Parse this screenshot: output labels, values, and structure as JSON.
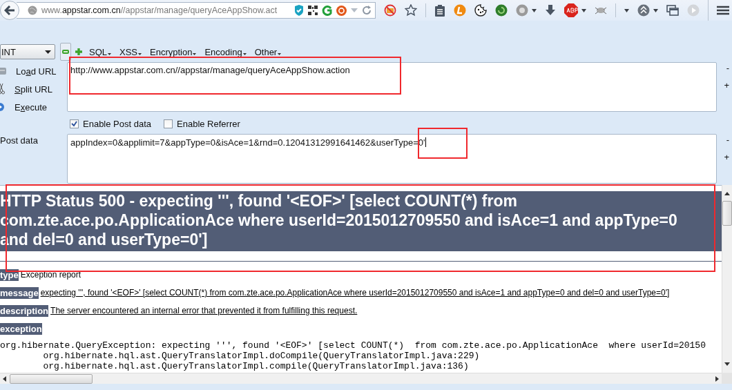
{
  "browser": {
    "address": "www.**appstar.com.cn**//appstar/manage/queryAceAppShow.act"
  },
  "hackbar": {
    "select": "INT",
    "menus": [
      "SQL",
      "XSS",
      "Encryption",
      "Encoding",
      "Other"
    ],
    "actions": [
      {
        "before": "Lo",
        "access_key": "a",
        "after": "d URL"
      },
      {
        "access_key": "S",
        "after": "plit URL"
      },
      {
        "before": "E",
        "access_key": "x",
        "after": "ecute"
      }
    ],
    "url": "http://www.appstar.com.cn//appstar/manage/queryAceAppShow.action",
    "url_side": [
      "-",
      "+"
    ],
    "options": [
      {
        "label": "Enable Post data",
        "checked": true
      },
      {
        "label": "Enable Referrer",
        "checked": false
      }
    ],
    "post_label": "Post data",
    "post_data": "appIndex=0&applimit=7&appType=0&isAce=1&rnd=0.12041312991641462&userType=0'",
    "post_side": [
      "-",
      "+"
    ]
  },
  "error_page": {
    "heading": "HTTP Status 500 - expecting ''', found '<EOF>' [select COUNT(*) from com.zte.ace.po.ApplicationAce where userId=2015012709550 and isAce=1 and appType=0 and del=0 and userType=0']",
    "fields": [
      {
        "label": "type",
        "value": "Exception report",
        "kind": "plain"
      },
      {
        "label": "message",
        "value": "expecting ''', found '<EOF>' [select COUNT(*) from com.zte.ace.po.ApplicationAce where userId=2015012709550 and isAce=1 and appType=0 and del=0 and userType=0']",
        "kind": "underlined"
      },
      {
        "label": "description",
        "value": "The server encountered an internal error that prevented it from fulfilling this request.",
        "kind": "underlined"
      },
      {
        "label": "exception",
        "kind": "plain"
      }
    ],
    "trace": [
      "org.hibernate.QueryException: expecting ''', found '<EOF>' [select COUNT(*)  from com.zte.ace.po.ApplicationAce  where userId=20150",
      "\torg.hibernate.hql.ast.QueryTranslatorImpl.doCompile(QueryTranslatorImpl.java:229)",
      "\torg.hibernate.hql.ast.QueryTranslatorImpl.compile(QueryTranslatorImpl.java:136)"
    ]
  }
}
